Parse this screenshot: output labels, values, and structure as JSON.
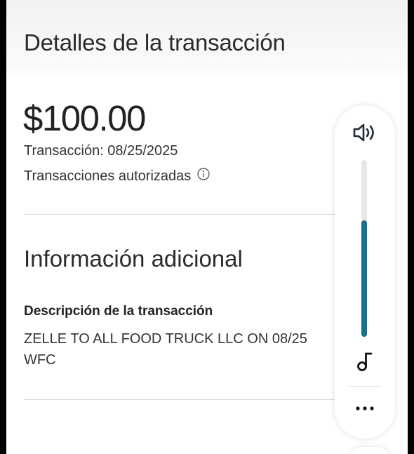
{
  "header": {
    "title": "Detalles de la transacción"
  },
  "transaction": {
    "amount": "$100.00",
    "date_line": "Transacción: 08/25/2025",
    "status": "Transacciones autorizadas"
  },
  "additional_info": {
    "section_title": "Información adicional",
    "description_label": "Descripción de la transacción",
    "description_line1": "ZELLE TO ALL FOOD TRUCK LLC ON 08/25",
    "description_line2": "WFC"
  },
  "volume_panel": {
    "level": 0.66,
    "icons": [
      "speaker-icon",
      "music-note-icon",
      "more-icon"
    ],
    "accent_color": "#1a6e91"
  }
}
